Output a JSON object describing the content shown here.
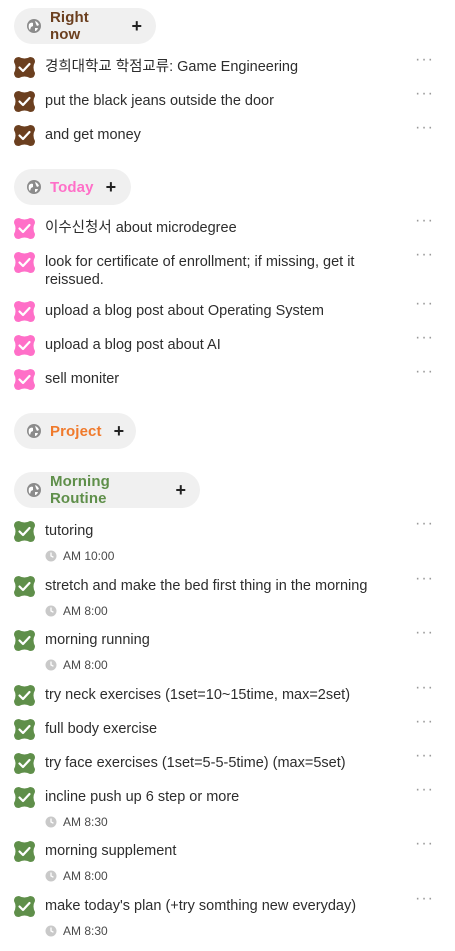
{
  "sections": [
    {
      "title": "Right now",
      "color": "#6b3f1f",
      "title_color": "#6b3f1f",
      "items": [
        {
          "text": "경희대학교 학점교류: Game Engineering"
        },
        {
          "text": "put the black jeans outside the door"
        },
        {
          "text": "and get money"
        }
      ]
    },
    {
      "title": "Today",
      "color": "#ff6fc8",
      "title_color": "#ff6fc8",
      "items": [
        {
          "text": "이수신청서 about microdegree"
        },
        {
          "text": "look for certificate of enrollment; if missing, get it reissued."
        },
        {
          "text": "upload a blog post about Operating System"
        },
        {
          "text": "upload a blog post about AI"
        },
        {
          "text": "sell moniter"
        }
      ]
    },
    {
      "title": "Project",
      "color": "#ff7a2f",
      "title_color": "#f07a2c",
      "items": []
    },
    {
      "title": "Morning Routine",
      "color": "#5f8f4a",
      "title_color": "#5f8f4a",
      "items": [
        {
          "text": "tutoring",
          "time": "AM 10:00"
        },
        {
          "text": "stretch and make the bed first thing in the morning",
          "time": "AM 8:00"
        },
        {
          "text": "morning running",
          "time": "AM 8:00"
        },
        {
          "text": "try neck exercises (1set=10~15time, max=2set)"
        },
        {
          "text": "full body exercise"
        },
        {
          "text": "try face exercises (1set=5-5-5time) (max=5set)"
        },
        {
          "text": "incline push up 6 step or more",
          "time": "AM 8:30"
        },
        {
          "text": "morning supplement",
          "time": "AM 8:00"
        },
        {
          "text": "make today's plan (+try somthing new everyday)",
          "time": "AM 8:30"
        }
      ]
    }
  ],
  "icons": {
    "header_icon": "globe-icon",
    "add_icon": "plus-icon",
    "check_icon": "checkbox-checked-icon",
    "more_icon": "more-horizontal-icon",
    "time_icon": "clock-icon"
  }
}
